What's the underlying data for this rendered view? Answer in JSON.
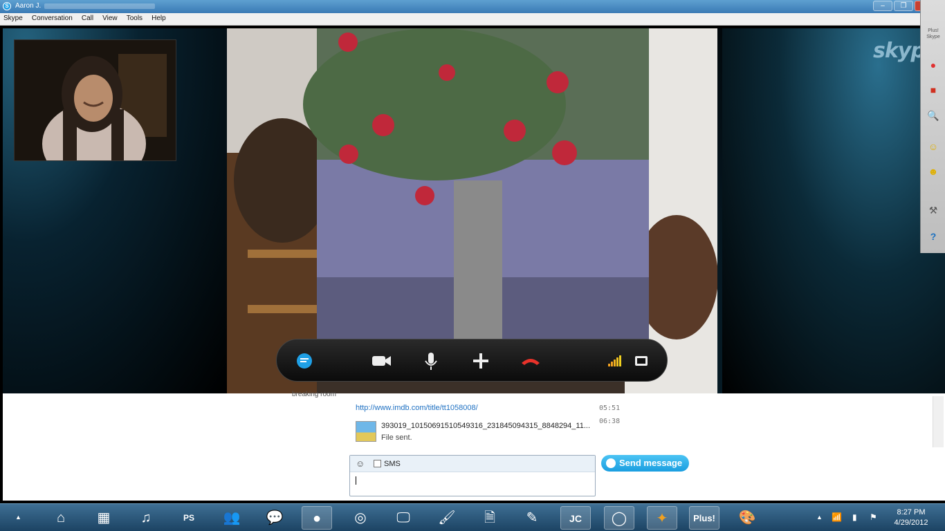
{
  "window": {
    "title": "Aaron J.",
    "minimize": "–",
    "maximize": "❐",
    "close": "✕"
  },
  "menu": [
    "Skype",
    "Conversation",
    "Call",
    "View",
    "Tools",
    "Help"
  ],
  "stage": {
    "logo": "skype",
    "plus_badge": "Plus! Skype"
  },
  "sidebar_tools": [
    {
      "name": "record-icon",
      "glyph": "●",
      "color": "#e03030"
    },
    {
      "name": "stop-icon",
      "glyph": "■",
      "color": "#d03020"
    },
    {
      "name": "search-icon",
      "glyph": "🔍",
      "color": "#444"
    },
    {
      "name": "emoticon-icon",
      "glyph": "☺",
      "color": "#e0b000"
    },
    {
      "name": "sound-icon",
      "glyph": "☻",
      "color": "#e0b000"
    },
    {
      "name": "settings-icon",
      "glyph": "⚒",
      "color": "#555"
    },
    {
      "name": "help-icon",
      "glyph": "?",
      "color": "#1a70c0"
    }
  ],
  "chat": {
    "cut_message": "breaking room",
    "link": "http://www.imdb.com/title/tt1058008/",
    "times": [
      "05:51",
      "06:38"
    ],
    "file_name": "393019_10150691510549316_231845094315_8848294_11...",
    "file_status": "File sent.",
    "sms_label": "SMS",
    "send_label": "Send message",
    "input_value": ""
  },
  "taskbar": {
    "time": "8:27 PM",
    "date": "4/29/2012"
  }
}
